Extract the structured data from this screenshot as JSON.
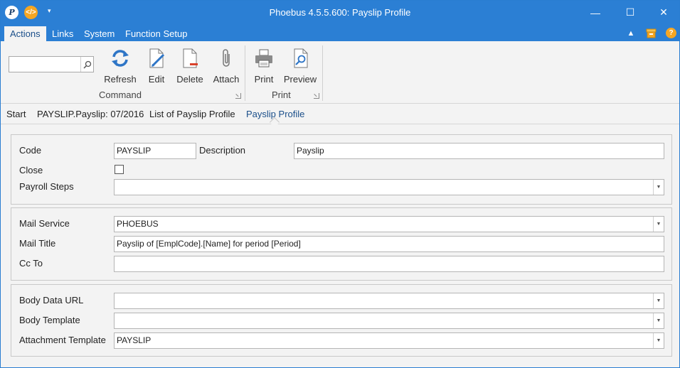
{
  "window": {
    "title": "Phoebus 4.5.5.600: Payslip Profile",
    "app_icon_letter": "P",
    "code_icon_glyph": "</>",
    "quick_access_glyph": "▾",
    "minimize_glyph": "—",
    "maximize_glyph": "☐",
    "close_glyph": "✕"
  },
  "menu_tabs": [
    {
      "label": "Actions",
      "active": true
    },
    {
      "label": "Links",
      "active": false
    },
    {
      "label": "System",
      "active": false
    },
    {
      "label": "Function Setup",
      "active": false
    }
  ],
  "tabbar_icons": {
    "collapse_glyph": "▲",
    "help_glyph": "?"
  },
  "ribbon": {
    "search": {
      "value": "",
      "placeholder": ""
    },
    "groups": {
      "command": {
        "label": "Command"
      },
      "print": {
        "label": "Print"
      }
    },
    "buttons": {
      "refresh": "Refresh",
      "edit": "Edit",
      "delete": "Delete",
      "attach": "Attach",
      "print": "Print",
      "preview": "Preview"
    }
  },
  "breadcrumb": [
    "Start",
    "PAYSLIP.Payslip: 07/2016",
    "List of Payslip Profile",
    "Payslip Profile"
  ],
  "form": {
    "code": {
      "label": "Code",
      "value": "PAYSLIP"
    },
    "description": {
      "label": "Description",
      "value": "Payslip"
    },
    "close": {
      "label": "Close",
      "checked": false
    },
    "payroll_steps": {
      "label": "Payroll Steps",
      "value": ""
    },
    "mail_service": {
      "label": "Mail Service",
      "value": "PHOEBUS"
    },
    "mail_title": {
      "label": "Mail Title",
      "value": "Payslip of [EmplCode].[Name] for period [Period]"
    },
    "cc_to": {
      "label": "Cc To",
      "value": ""
    },
    "body_data_url": {
      "label": "Body Data URL",
      "value": ""
    },
    "body_template": {
      "label": "Body Template",
      "value": ""
    },
    "attachment_template": {
      "label": "Attachment Template",
      "value": "PAYSLIP"
    }
  },
  "colors": {
    "titlebar": "#2b7fd4",
    "active_tab_text": "#1b4f8a",
    "help_icon": "#f5a623"
  }
}
